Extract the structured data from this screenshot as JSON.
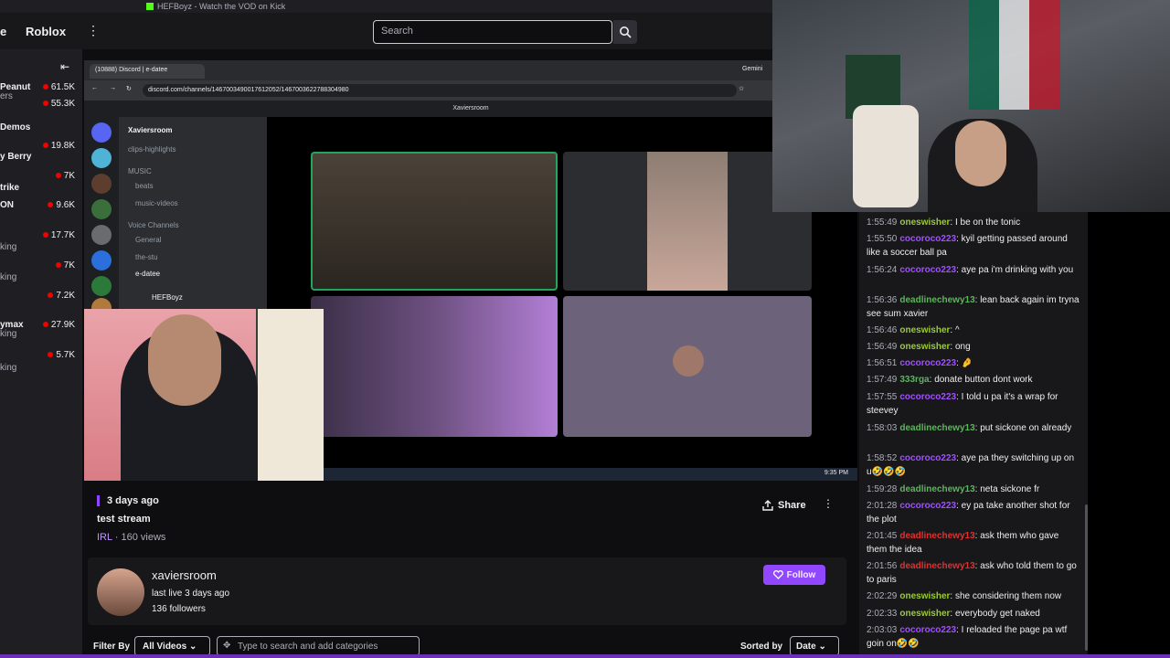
{
  "os_strip": {
    "tab_title": "HEFBoyz - Watch the VOD on Kick"
  },
  "topnav": {
    "edge_text": "e",
    "category": "Roblox",
    "search_placeholder": "Search"
  },
  "sidebar": {
    "items": [
      {
        "name": "Peanut",
        "sub": "ers",
        "viewers": "61.5K"
      },
      {
        "name": "",
        "sub": "",
        "viewers": "55.3K"
      },
      {
        "name": "Demos",
        "sub": "",
        "viewers": ""
      },
      {
        "name": "",
        "sub": "",
        "viewers": "19.8K"
      },
      {
        "name": "y Berry",
        "sub": "",
        "viewers": ""
      },
      {
        "name": "",
        "sub": "",
        "viewers": "7K"
      },
      {
        "name": "trike",
        "sub": "",
        "viewers": ""
      },
      {
        "name": "ON",
        "sub": "",
        "viewers": "9.6K"
      },
      {
        "name": "",
        "sub": "",
        "viewers": "17.7K"
      },
      {
        "name": "",
        "sub": "king",
        "viewers": ""
      },
      {
        "name": "",
        "sub": "",
        "viewers": "7K"
      },
      {
        "name": "",
        "sub": "king",
        "viewers": ""
      },
      {
        "name": "",
        "sub": "",
        "viewers": "7.2K"
      },
      {
        "name": "ymax",
        "sub": "king",
        "viewers": "27.9K"
      },
      {
        "name": "",
        "sub": "",
        "viewers": "5.7K"
      },
      {
        "name": "",
        "sub": "king",
        "viewers": ""
      }
    ]
  },
  "player": {
    "browser_tab": "(10888) Discord | e-datee",
    "browser_tab_right": "Gemini",
    "url": "discord.com/channels/1467003490017612052/1467003622788304980",
    "discord_header": "Xaviersroom",
    "server_name": "Xaviersroom",
    "channels": [
      "clips-highlights",
      "MUSIC",
      "beats",
      "music-videos",
      "Voice Channels",
      "General",
      "the-stu",
      "e-datee",
      "HEFBoyz"
    ],
    "taskbar_time": "9:35 PM"
  },
  "video": {
    "date": "3 days ago",
    "title": "test stream",
    "category": "IRL",
    "views": " · 160 views",
    "share_label": "Share"
  },
  "channel": {
    "name": "xaviersroom",
    "last_live": "last live 3 days ago",
    "followers": "136 followers",
    "follow_label": "Follow"
  },
  "filters": {
    "filter_by": "Filter By",
    "filter_value": "All Videos",
    "category_placeholder": "Type to search and add categories",
    "sorted_by": "Sorted by",
    "sort_value": "Date"
  },
  "chat": {
    "messages": [
      {
        "ts": "1:55:49",
        "user": "oneswisher",
        "color": "#9acd32",
        "text": "I be on the tonic"
      },
      {
        "ts": "1:55:50",
        "user": "cocoroco223",
        "color": "#a050ff",
        "text": "kyil getting passed around like a soccer ball pa"
      },
      {
        "ts": "1:56:24",
        "user": "cocoroco223",
        "color": "#a050ff",
        "text": "aye pa i'm drinking with you"
      },
      {
        "ts": "1:56:36",
        "user": "deadlinechewy13",
        "color": "#5fb35f",
        "text": "lean back again im tryna see sum xavier"
      },
      {
        "ts": "1:56:46",
        "user": "oneswisher",
        "color": "#9acd32",
        "text": "^"
      },
      {
        "ts": "1:56:49",
        "user": "oneswisher",
        "color": "#9acd32",
        "text": "ong"
      },
      {
        "ts": "1:56:51",
        "user": "cocoroco223",
        "color": "#a050ff",
        "text": "🤌"
      },
      {
        "ts": "1:57:49",
        "user": "333rga",
        "color": "#5fb35f",
        "text": "donate button dont work"
      },
      {
        "ts": "1:57:55",
        "user": "cocoroco223",
        "color": "#a050ff",
        "text": "I told u pa it's a wrap for steevey"
      },
      {
        "ts": "1:58:03",
        "user": "deadlinechewy13",
        "color": "#5fb35f",
        "text": "put sickone on already"
      },
      {
        "ts": "1:58:52",
        "user": "cocoroco223",
        "color": "#a050ff",
        "text": "aye pa they switching up on u🤣🤣🤣"
      },
      {
        "ts": "1:59:28",
        "user": "deadlinechewy13",
        "color": "#5fb35f",
        "text": "neta sickone fr"
      },
      {
        "ts": "2:01:28",
        "user": "cocoroco223",
        "color": "#a050ff",
        "text": "ey pa take another shot for the plot"
      },
      {
        "ts": "2:01:45",
        "user": "deadlinechewy13",
        "color": "#e03030",
        "text": "ask them who gave them the idea"
      },
      {
        "ts": "2:01:56",
        "user": "deadlinechewy13",
        "color": "#e03030",
        "text": "ask who told them to go to paris"
      },
      {
        "ts": "2:02:29",
        "user": "oneswisher",
        "color": "#9acd32",
        "text": "she considering them now"
      },
      {
        "ts": "2:02:33",
        "user": "oneswisher",
        "color": "#9acd32",
        "text": "everybody get naked"
      },
      {
        "ts": "2:03:03",
        "user": "cocoroco223",
        "color": "#a050ff",
        "text": "I reloaded the page pa wtf goin on🤣🤣"
      }
    ]
  },
  "colors": {
    "accent": "#9147ff",
    "live": "#eb0400",
    "kick": "#53fc18"
  }
}
